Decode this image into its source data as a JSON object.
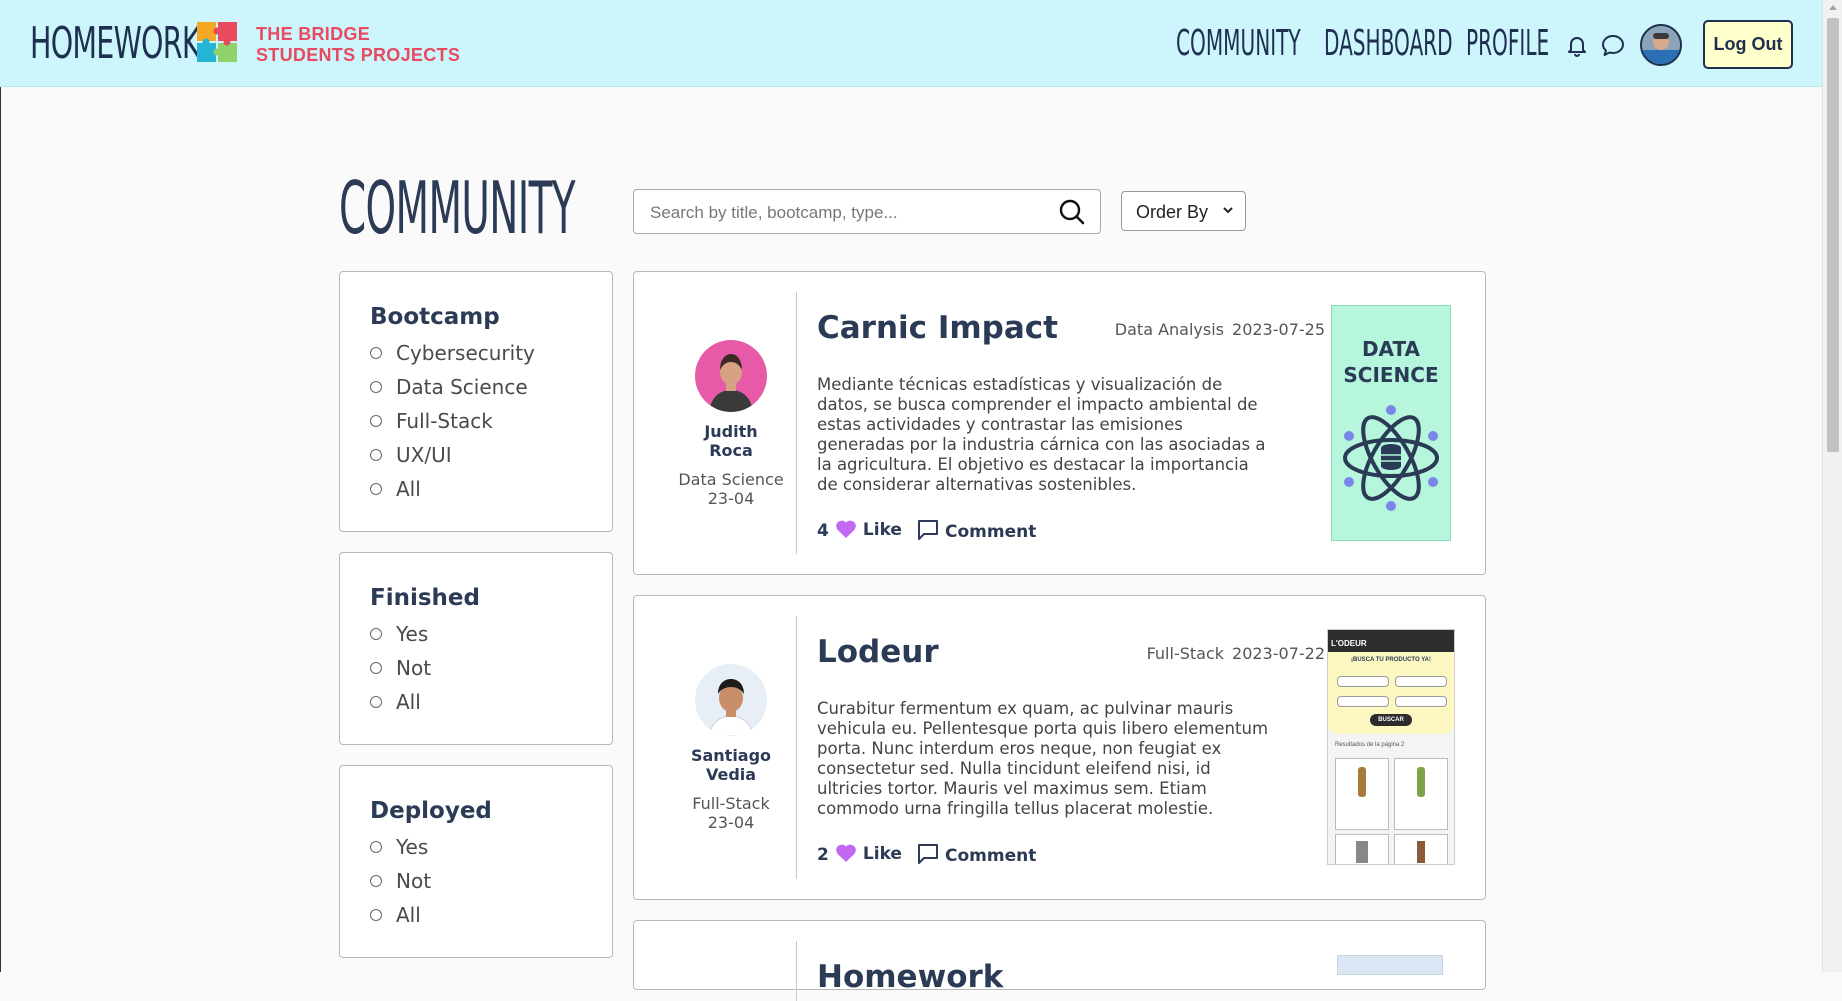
{
  "header": {
    "brand": "HOMEWORK",
    "tagline_line1": "THE BRIDGE",
    "tagline_line2": "STUDENTS PROJECTS",
    "nav": [
      "COMMUNITY",
      "DASHBOARD",
      "PROFILE"
    ],
    "logout_label": "Log Out"
  },
  "page": {
    "title": "COMMUNITY",
    "search_placeholder": "Search by title, bootcamp, type...",
    "order_label": "Order By"
  },
  "filters": [
    {
      "title": "Bootcamp",
      "options": [
        "Cybersecurity",
        "Data Science",
        "Full-Stack",
        "UX/UI",
        "All"
      ]
    },
    {
      "title": "Finished",
      "options": [
        "Yes",
        "Not",
        "All"
      ]
    },
    {
      "title": "Deployed",
      "options": [
        "Yes",
        "Not",
        "All"
      ]
    }
  ],
  "projects": [
    {
      "title": "Carnic Impact",
      "type": "Data Analysis",
      "date": "2023-07-25",
      "author_first": "Judith",
      "author_last": "Roca",
      "bootcamp": "Data Science",
      "edition": "23-04",
      "description": "Mediante técnicas estadísticas y visualización de datos, se busca comprender el impacto ambiental de estas actividades y contrastar las emisiones generadas por la industria cárnica con las asociadas a la agricultura. El objetivo es destacar la importancia de considerar alternativas sostenibles.",
      "likes": "4",
      "like_label": "Like",
      "comment_label": "Comment",
      "thumb_text_1": "DATA",
      "thumb_text_2": "SCIENCE"
    },
    {
      "title": "Lodeur",
      "type": "Full-Stack",
      "date": "2023-07-22",
      "author_first": "Santiago",
      "author_last": "Vedia",
      "bootcamp": "Full-Stack",
      "edition": "23-04",
      "description": "Curabitur fermentum ex quam, ac pulvinar mauris vehicula eu. Pellentesque porta quis libero elementum porta. Nunc interdum eros neque, non feugiat ex consectetur sed. Nulla tincidunt eleifend nisi, id ultricies tortor. Mauris vel maximus sem. Etiam commodo urna fringilla tellus placerat molestie.",
      "likes": "2",
      "like_label": "Like",
      "comment_label": "Comment",
      "thumb_brand": "L'ODEUR",
      "thumb_heading": "¡BUSCA TU PRODUCTO YA!",
      "thumb_button": "BUSCAR",
      "thumb_results": "Resultados de la página 2"
    },
    {
      "title": "Homework"
    }
  ],
  "colors": {
    "header_bg": "#ccf5fc",
    "brand_text": "#1e2f4f",
    "tagline": "#e84a5f",
    "like_heart": "#c368f2",
    "thumb_ds_bg": "#b5f6dc",
    "logout_bg": "#ffffcc"
  }
}
